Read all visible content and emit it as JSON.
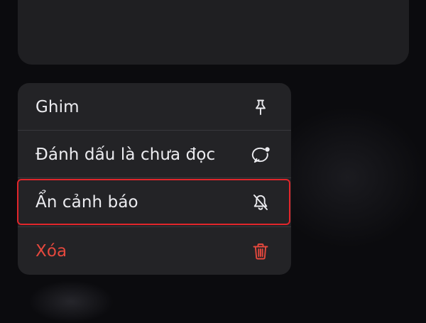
{
  "context_menu": {
    "items": [
      {
        "label": "Ghim",
        "icon": "pin-icon",
        "destructive": false
      },
      {
        "label": "Đánh dấu là chưa đọc",
        "icon": "unread-bubble-icon",
        "destructive": false
      },
      {
        "label": "Ẩn cảnh báo",
        "icon": "bell-slash-icon",
        "destructive": false
      },
      {
        "label": "Xóa",
        "icon": "trash-icon",
        "destructive": true
      }
    ]
  },
  "colors": {
    "menu_background": "#232326",
    "text": "#ececf0",
    "destructive": "#e5483d",
    "highlight_border": "#e1262b"
  }
}
